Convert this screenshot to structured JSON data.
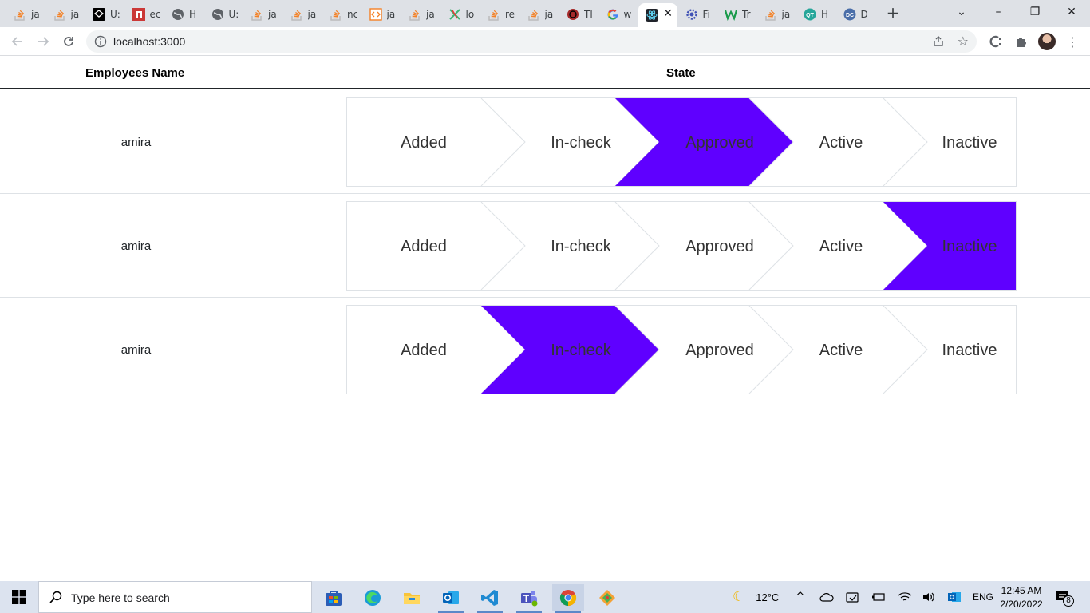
{
  "browser": {
    "tabs": [
      {
        "title": "ja",
        "icon": "stackoverflow-icon"
      },
      {
        "title": "ja",
        "icon": "stackoverflow-icon"
      },
      {
        "title": "U:",
        "icon": "codepen-icon"
      },
      {
        "title": "ec",
        "icon": "npm-icon"
      },
      {
        "title": "H",
        "icon": "globe-icon"
      },
      {
        "title": "U:",
        "icon": "globe-icon"
      },
      {
        "title": "ja",
        "icon": "stackoverflow-icon"
      },
      {
        "title": "ja",
        "icon": "stackoverflow-icon"
      },
      {
        "title": "nc",
        "icon": "stackoverflow-icon"
      },
      {
        "title": "ja",
        "icon": "code-icon"
      },
      {
        "title": "ja",
        "icon": "stackoverflow-icon"
      },
      {
        "title": "lo",
        "icon": "compass-icon"
      },
      {
        "title": "re",
        "icon": "stackoverflow-icon"
      },
      {
        "title": "ja",
        "icon": "stackoverflow-icon"
      },
      {
        "title": "Tl",
        "icon": "circle-logo-icon"
      },
      {
        "title": "w",
        "icon": "google-icon"
      },
      {
        "title": "",
        "icon": "react-icon",
        "active": true
      },
      {
        "title": "Fi",
        "icon": "gear-logo-icon"
      },
      {
        "title": "Tr",
        "icon": "w-logo-icon"
      },
      {
        "title": "ja",
        "icon": "stackoverflow-icon"
      },
      {
        "title": "H",
        "icon": "qt-icon"
      },
      {
        "title": "D",
        "icon": "dc-icon"
      }
    ],
    "address": "localhost:3000"
  },
  "table": {
    "headers": {
      "name": "Employees Name",
      "state": "State"
    },
    "steps": [
      "Added",
      "In-check",
      "Approved",
      "Active",
      "Inactive"
    ],
    "rows": [
      {
        "name": "amira",
        "active_step": "Approved"
      },
      {
        "name": "amira",
        "active_step": "Inactive"
      },
      {
        "name": "amira",
        "active_step": "In-check"
      }
    ]
  },
  "colors": {
    "active_step": "#5f00ff",
    "divider": "#dee2e6"
  },
  "taskbar": {
    "search_placeholder": "Type here to search",
    "weather": "12°C",
    "language": "ENG",
    "time": "12:45 AM",
    "date": "2/20/2022",
    "notification_count": "8"
  }
}
